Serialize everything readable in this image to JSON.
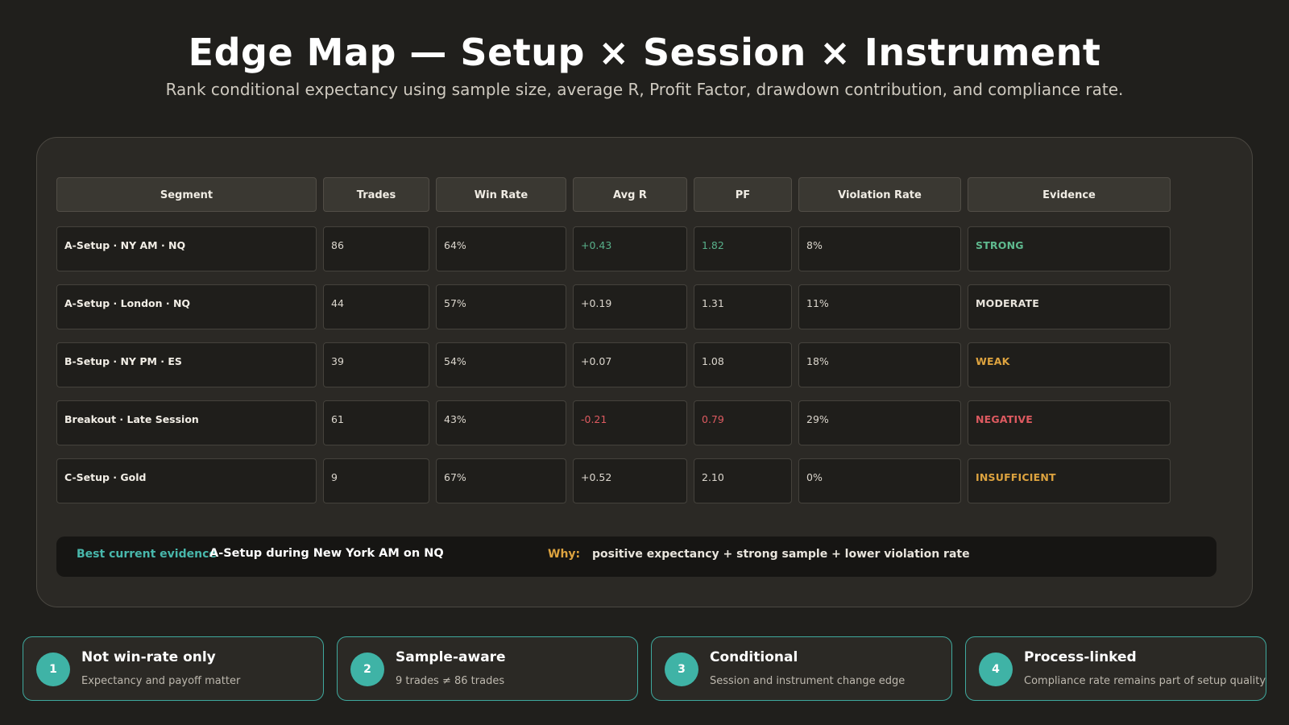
{
  "header": {
    "title": "Edge Map — Setup × Session × Instrument",
    "subtitle": "Rank conditional expectancy using sample size, average R, Profit Factor, drawdown contribution, and compliance rate."
  },
  "table": {
    "headers": [
      "Segment",
      "Trades",
      "Win Rate",
      "Avg R",
      "PF",
      "Violation Rate",
      "Evidence"
    ],
    "rows": [
      {
        "segment": "A-Setup · NY AM · NQ",
        "trades": "86",
        "win_rate": "64%",
        "avg_r": "+0.43",
        "pf": "1.82",
        "violation_rate": "8%",
        "evidence": "STRONG"
      },
      {
        "segment": "A-Setup · London · NQ",
        "trades": "44",
        "win_rate": "57%",
        "avg_r": "+0.19",
        "pf": "1.31",
        "violation_rate": "11%",
        "evidence": "MODERATE"
      },
      {
        "segment": "B-Setup · NY PM · ES",
        "trades": "39",
        "win_rate": "54%",
        "avg_r": "+0.07",
        "pf": "1.08",
        "violation_rate": "18%",
        "evidence": "WEAK"
      },
      {
        "segment": "Breakout · Late Session",
        "trades": "61",
        "win_rate": "43%",
        "avg_r": "-0.21",
        "pf": "0.79",
        "violation_rate": "29%",
        "evidence": "NEGATIVE"
      },
      {
        "segment": "C-Setup · Gold",
        "trades": "9",
        "win_rate": "67%",
        "avg_r": "+0.52",
        "pf": "2.10",
        "violation_rate": "0%",
        "evidence": "INSUFFICIENT"
      }
    ]
  },
  "summary": {
    "label": "Best current evidence",
    "value": "A-Setup during New York AM on NQ",
    "why_label": "Why:",
    "why_value": "positive expectancy + strong sample + lower violation rate"
  },
  "cards": [
    {
      "number": "1",
      "title": "Not win-rate only",
      "desc": "Expectancy and payoff matter"
    },
    {
      "number": "2",
      "title": "Sample-aware",
      "desc": "9 trades ≠ 86 trades"
    },
    {
      "number": "3",
      "title": "Conditional",
      "desc": "Session and instrument change edge"
    },
    {
      "number": "4",
      "title": "Process-linked",
      "desc": "Compliance rate remains part of setup quality"
    }
  ],
  "colors": {
    "background": "#201f1c",
    "panel": "#2b2925",
    "accent_teal": "#3fb3a6",
    "positive_green": "#58b08a",
    "negative_red": "#dd5a60",
    "warning_amber": "#dda33f"
  }
}
